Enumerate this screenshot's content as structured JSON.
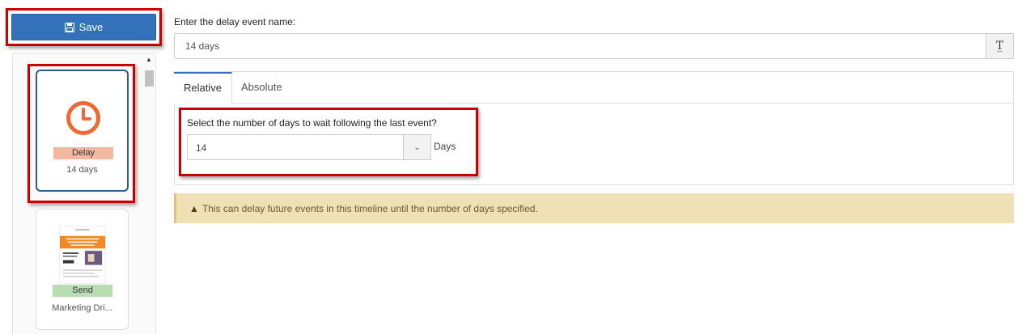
{
  "toolbar": {
    "save_label": "Save"
  },
  "sidebar": {
    "items": [
      {
        "tag": "Delay",
        "subtitle": "14 days",
        "icon": "clock-icon",
        "tag_color": "#f4b8a0"
      },
      {
        "tag": "Send",
        "subtitle": "Marketing Dri...",
        "icon": "email-thumbnail",
        "tag_color": "#b8ddb0"
      }
    ]
  },
  "form": {
    "name_label": "Enter the delay event name:",
    "name_value": "14 days",
    "name_addon_icon": "text-format-icon",
    "tabs": [
      {
        "label": "Relative",
        "active": true
      },
      {
        "label": "Absolute",
        "active": false
      }
    ],
    "days_question": "Select the number of days to wait following the last event?",
    "days_value": "14",
    "days_unit": "Days",
    "alert_text": "This can delay future events in this timeline until the number of days specified."
  },
  "colors": {
    "accent": "#3371b8",
    "highlight": "#cc0000",
    "clock": "#ee6a35",
    "alert_bg": "#efe0b6"
  }
}
